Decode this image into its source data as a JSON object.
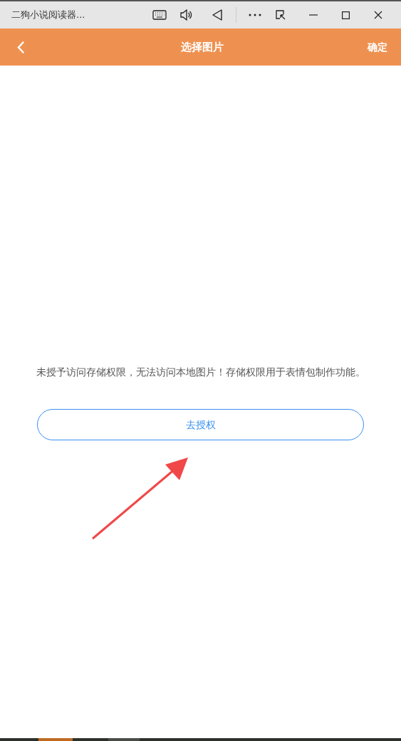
{
  "window": {
    "title": "二狗小说阅读器..."
  },
  "header": {
    "title": "选择图片",
    "confirm": "确定"
  },
  "message": "未授予访问存储权限，无法访问本地图片！存储权限用于表情包制作功能。",
  "authorize_button": "去授权"
}
